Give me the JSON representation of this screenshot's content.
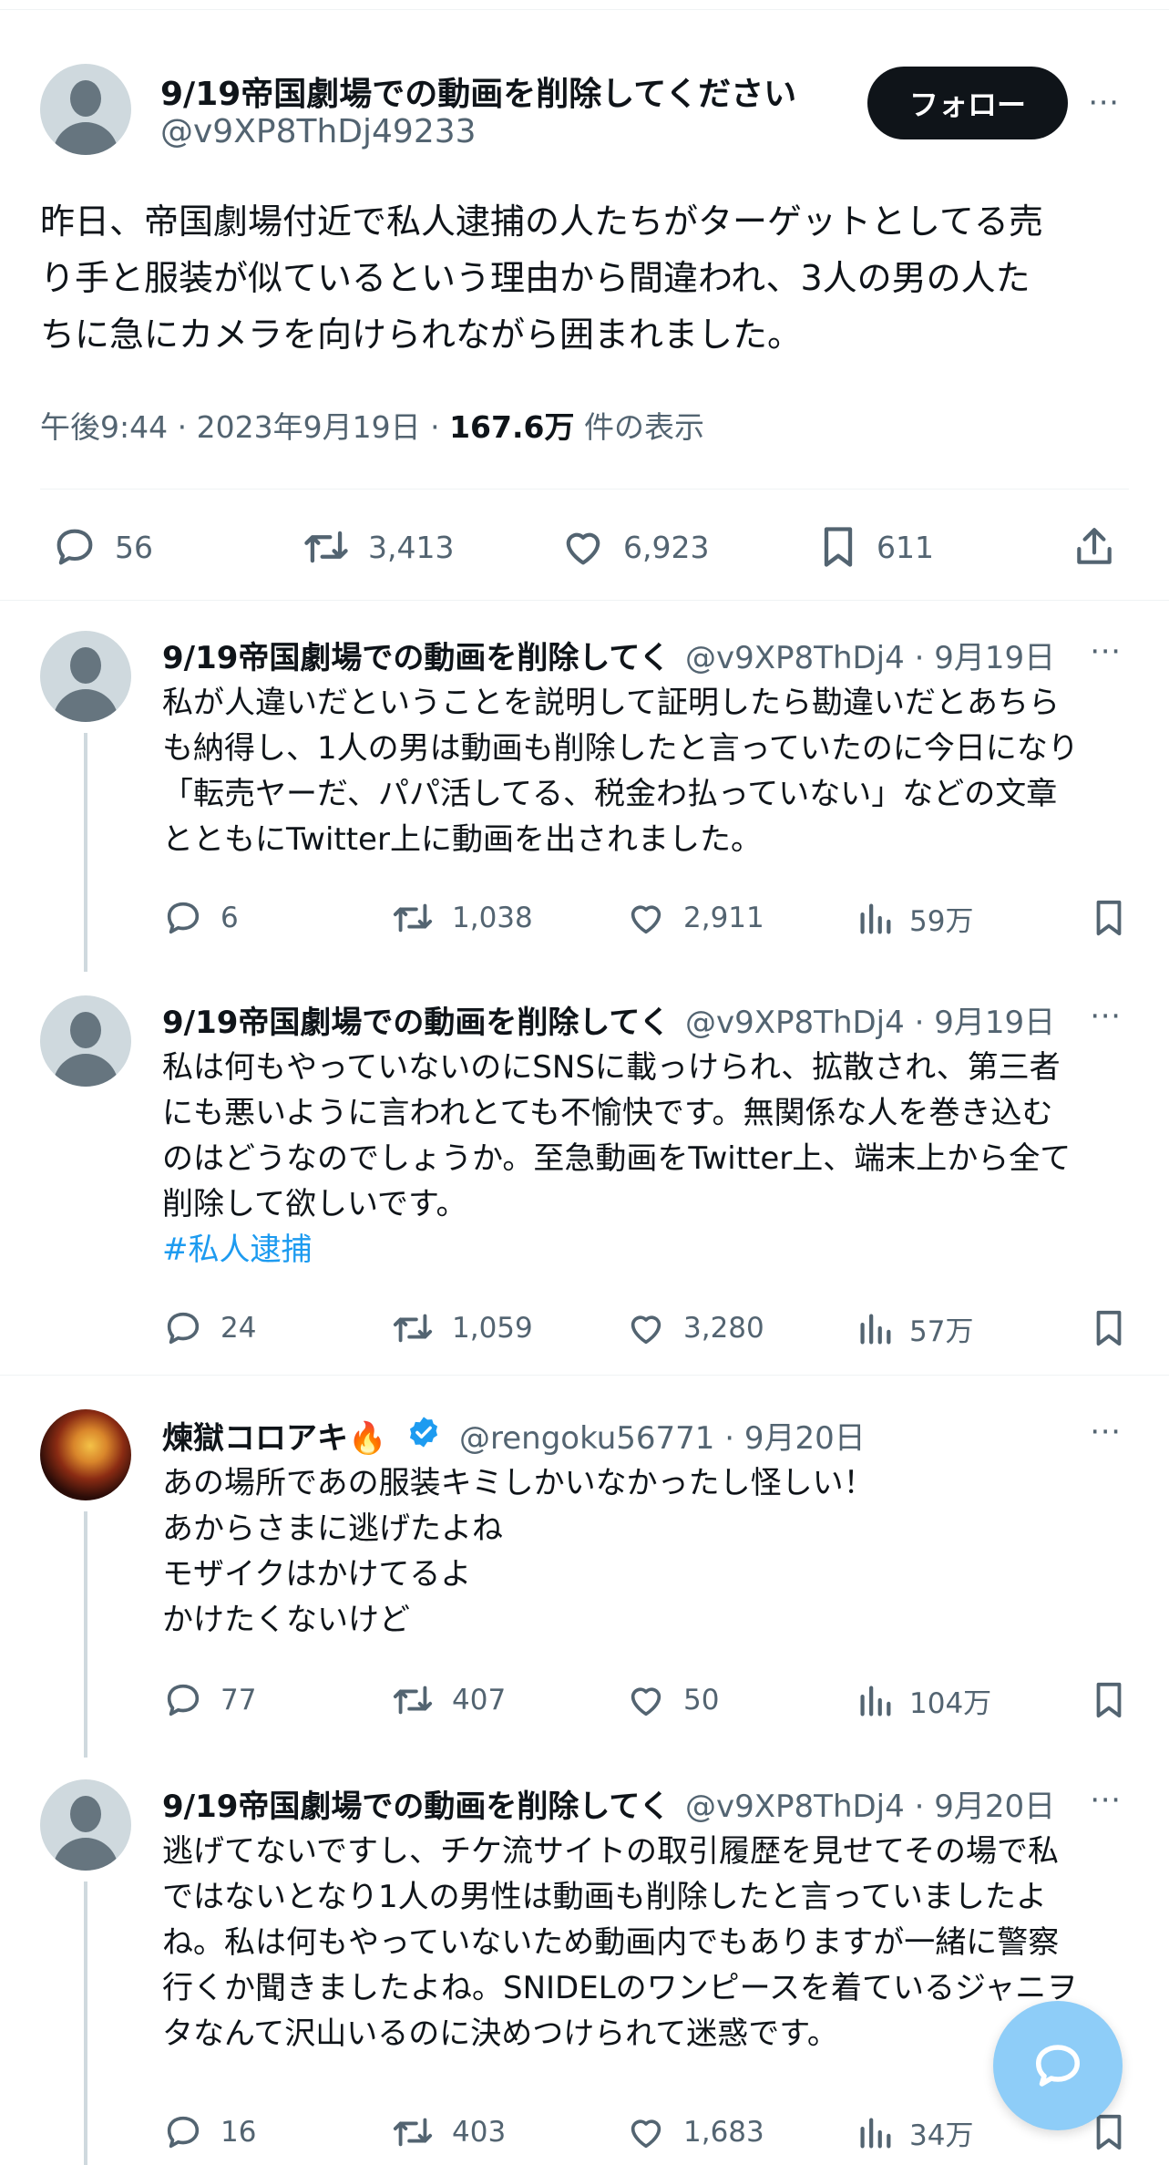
{
  "main_tweet": {
    "name": "9/19帝国劇場での動画を削除してください",
    "handle": "@v9XP8ThDj49233",
    "follow_label": "フォロー",
    "text_lines": [
      "昨日、帝国劇場付近で私人逮捕の人たちがターゲットとしてる売",
      "り手と服装が似ているという理由から間違われ、3人の男の人た",
      "ちに急にカメラを向けられながら囲まれました。"
    ],
    "time": "午後9:44",
    "date": "2023年9月19日",
    "views": "167.6万",
    "views_label": "件の表示",
    "replies": "56",
    "retweets": "3,413",
    "likes": "6,923",
    "bookmarks": "611"
  },
  "replies": [
    {
      "name": "9/19帝国劇場での動画を削除してく",
      "handle": "@v9XP8ThDj4",
      "date": "9月19日",
      "lines": [
        "私が人違いだということを説明して証明したら勘違いだとあちら",
        "も納得し、1人の男は動画も削除したと言っていたのに今日になり",
        "「転売ヤーだ、パパ活してる、税金わ払っていない」などの文章",
        "とともにTwitter上に動画を出されました。"
      ],
      "replies": "6",
      "retweets": "1,038",
      "likes": "2,911",
      "views": "59万"
    },
    {
      "name": "9/19帝国劇場での動画を削除してく",
      "handle": "@v9XP8ThDj4",
      "date": "9月19日",
      "lines": [
        "私は何もやっていないのにSNSに載っけられ、拡散され、第三者",
        "にも悪いように言われとても不愉快です。無関係な人を巻き込む",
        "のはどうなのでしょうか。至急動画をTwitter上、端末上から全て",
        "削除して欲しいです。"
      ],
      "hashtag": "#私人逮捕",
      "replies": "24",
      "retweets": "1,059",
      "likes": "3,280",
      "views": "57万"
    },
    {
      "name": "煉獄コロアキ🔥",
      "handle": "@rengoku56771",
      "date": "9月20日",
      "lines": [
        "あの場所であの服装キミしかいなかったし怪しい！",
        "あからさまに逃げたよね",
        "モザイクはかけてるよ",
        "かけたくないけど"
      ],
      "replies": "77",
      "retweets": "407",
      "likes": "50",
      "views": "104万"
    },
    {
      "name": "9/19帝国劇場での動画を削除してく",
      "handle": "@v9XP8ThDj4",
      "date": "9月20日",
      "lines": [
        "逃げてないですし、チケ流サイトの取引履歴を見せてその場で私",
        "ではないとなり1人の男性は動画も削除したと言っていましたよ",
        "ね。私は何もやっていないため動画内でもありますが一緒に警察",
        "行くか聞きましたよね。SNIDELのワンピースを着ているジャニヲ",
        "タなんて沢山いるのに決めつけられて迷惑です。"
      ],
      "replies": "16",
      "retweets": "403",
      "likes": "1,683",
      "views": "34万"
    }
  ],
  "separator": "·",
  "more_icon": "⋯",
  "colors": {
    "accent": "#1d9bf0",
    "muted": "#536471",
    "fab": "#8ecdf8"
  }
}
